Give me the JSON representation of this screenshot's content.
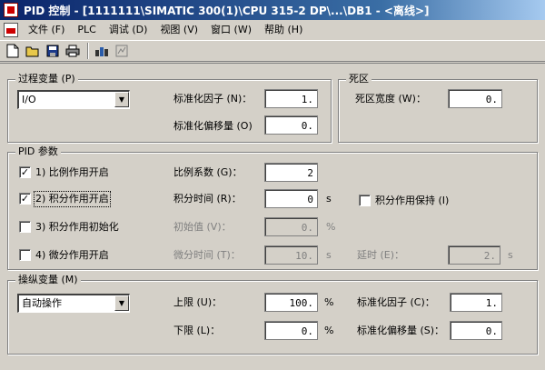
{
  "window": {
    "title": "PID 控制 - [1111111\\SIMATIC 300(1)\\CPU 315-2 DP\\...\\DB1 - <离线>]"
  },
  "menu": {
    "items": [
      "文件 (F)",
      "PLC",
      "调试 (D)",
      "视图 (V)",
      "窗口 (W)",
      "帮助 (H)"
    ]
  },
  "toolbar": {
    "icons": [
      "new-icon",
      "open-icon",
      "save-icon",
      "print-icon",
      "download-icon",
      "monitor-icon"
    ]
  },
  "process_variable": {
    "title": "过程变量 (P)",
    "selected": "I/O",
    "norm_factor_label": "标准化因子 (N)：",
    "norm_factor_value": "1.",
    "norm_offset_label": "标准化偏移量 (O)",
    "norm_offset_value": "0."
  },
  "deadband": {
    "title": "死区",
    "width_label": "死区宽度 (W)：",
    "width_value": "0."
  },
  "pid": {
    "title": "PID 参数",
    "p_on_label": "1) 比例作用开启",
    "i_on_label": "2) 积分作用开启",
    "i_init_label": "3) 积分作用初始化",
    "d_on_label": "4) 微分作用开启",
    "gain_label": "比例系数 (G)：",
    "gain_value": "2",
    "ti_label": "积分时间 (R)：",
    "ti_value": "0",
    "ti_unit": "s",
    "i_hold_label": "积分作用保持 (I)",
    "init_label": "初始值 (V)：",
    "init_value": "0.",
    "init_unit": "%",
    "td_label": "微分时间 (T)：",
    "td_value": "10.",
    "td_unit": "s",
    "delay_label": "延时 (E)：",
    "delay_value": "2.",
    "delay_unit": "s",
    "check": "✓"
  },
  "manipulated": {
    "title": "操纵变量 (M)",
    "selected": "自动操作",
    "upper_label": "上限 (U)：",
    "upper_value": "100.",
    "upper_unit": "%",
    "lower_label": "下限 (L)：",
    "lower_value": "0.",
    "lower_unit": "%",
    "norm_factor_label": "标准化因子 (C)：",
    "norm_factor_value": "1.",
    "norm_offset_label": "标准化偏移量 (S)：",
    "norm_offset_value": "0."
  },
  "glyphs": {
    "dropdown": "▼"
  }
}
